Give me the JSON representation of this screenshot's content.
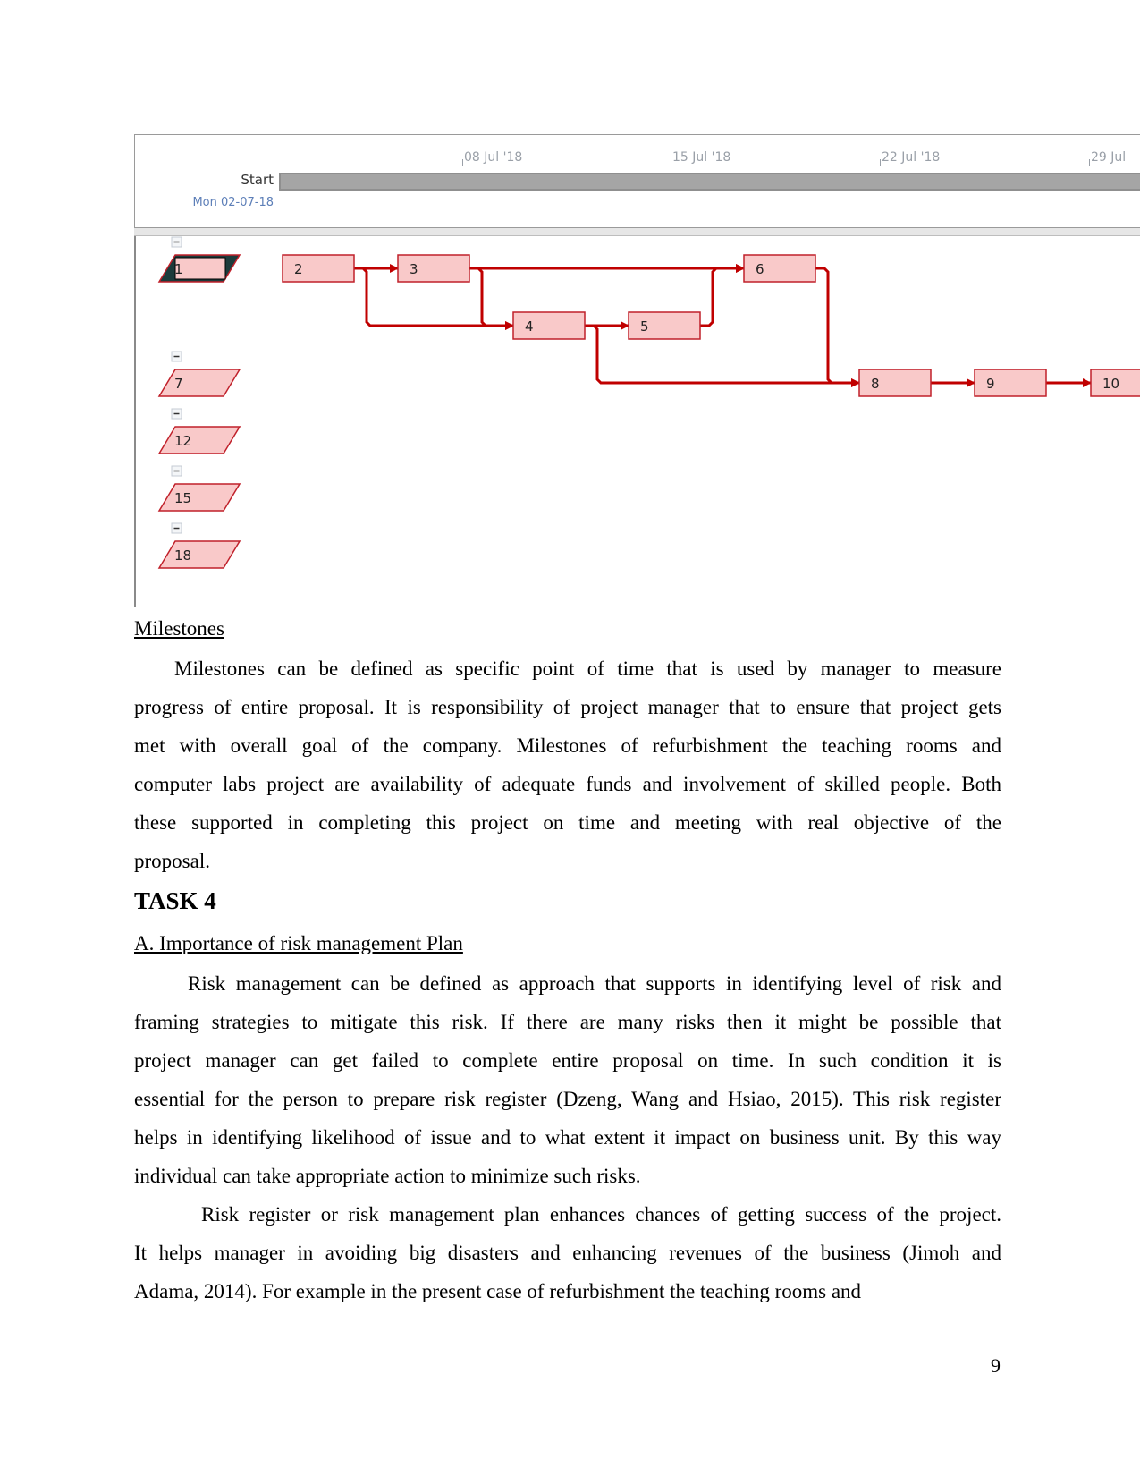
{
  "figure": {
    "timescale": {
      "ticks": [
        "08 Jul '18",
        "15 Jul '18",
        "22 Jul '18",
        "29 Jul"
      ],
      "start_label": "Start",
      "start_date": "Mon 02-07-18"
    },
    "colors": {
      "node_fill": "#f9c9c9",
      "node_border": "#c0202a",
      "link": "#c00000",
      "summary_dark": "#1c3b3b",
      "bar": "#a5a5a5"
    },
    "summary_nodes": [
      {
        "id": "1",
        "selected": true
      },
      {
        "id": "7"
      },
      {
        "id": "12"
      },
      {
        "id": "15"
      },
      {
        "id": "18"
      }
    ],
    "task_nodes": [
      "2",
      "3",
      "4",
      "5",
      "6",
      "8",
      "9",
      "10"
    ],
    "links": [
      [
        "2",
        "3"
      ],
      [
        "2",
        "4"
      ],
      [
        "3",
        "6"
      ],
      [
        "3",
        "4"
      ],
      [
        "4",
        "5"
      ],
      [
        "5",
        "6"
      ],
      [
        "4",
        "8"
      ],
      [
        "6",
        "8"
      ],
      [
        "8",
        "9"
      ],
      [
        "9",
        "10"
      ]
    ]
  },
  "milestones": {
    "heading": "Milestones",
    "lines": [
      "Milestones can be defined as specific point of time that is used by manager to measure",
      "progress of entire proposal. It is responsibility of project manager that to ensure that project gets",
      "met with overall goal of the company. Milestones of refurbishment the teaching rooms and",
      "computer labs project are availability of adequate funds and involvement of skilled people. Both",
      "these supported in completing this project on time and meeting with real objective of the",
      "proposal."
    ]
  },
  "task4": {
    "heading": "TASK 4",
    "subheading": "A. Importance of risk management Plan",
    "para1": [
      "Risk management can be defined as approach that supports in identifying level of risk and",
      "framing strategies to mitigate this risk. If there are many risks then it might be possible that",
      "project manager can get failed to complete entire proposal on time. In such condition it is",
      "essential for the person to prepare risk register (Dzeng, Wang and Hsiao, 2015). This risk register",
      "helps in identifying likelihood of issue and to what extent it impact on business unit. By this way",
      "individual can take appropriate action to minimize such risks."
    ],
    "para2": [
      "Risk register or risk management plan enhances chances of getting success of the project.",
      "It helps manager in avoiding big disasters and enhancing revenues of the business (Jimoh and",
      "Adama, 2014). For example in the present case of refurbishment the teaching rooms and"
    ]
  },
  "page_number": "9"
}
